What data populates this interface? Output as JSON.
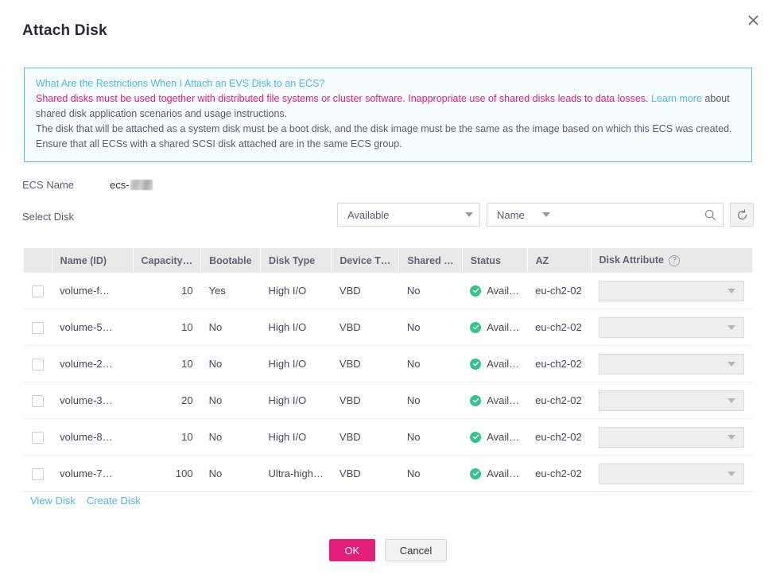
{
  "dialog": {
    "title": "Attach Disk",
    "close_icon": "close-icon"
  },
  "notice": {
    "heading_link": "What Are the Restrictions When I Attach an EVS Disk to an ECS?",
    "warning_part1": "Shared disks must be used together with distributed file systems or cluster software. Inappropriate use of shared disks leads to data losses. ",
    "warning_link": "Learn more",
    "warning_part2": " about shared disk application scenarios and usage instructions.",
    "line3": "The disk that will be attached as a system disk must be a boot disk, and the disk image must be the same as the image based on which this ECS was created.",
    "line4": "Ensure that all ECSs with a shared SCSI disk attached are in the same ECS group."
  },
  "form": {
    "ecs_name_label": "ECS Name",
    "ecs_name_value": "ecs-",
    "select_disk_label": "Select Disk"
  },
  "search": {
    "status_filter_value": "Available",
    "field_filter_value": "Name",
    "keyword_value": "",
    "keyword_placeholder": "",
    "search_icon": "search-icon",
    "refresh_icon": "refresh-icon"
  },
  "table": {
    "columns": [
      "Name (ID)",
      "Capacity…",
      "Bootable",
      "Disk Type",
      "Device T…",
      "Shared …",
      "Status",
      "AZ",
      "Disk Attribute"
    ],
    "disk_attribute_help_icon": "help-icon",
    "rows": [
      {
        "name": "volume-f…",
        "capacity": "10",
        "bootable": "Yes",
        "disk_type": "High I/O",
        "device_type": "VBD",
        "shared": "No",
        "status": "Avail…",
        "az": "eu-ch2-02",
        "disk_attribute": ""
      },
      {
        "name": "volume-5…",
        "capacity": "10",
        "bootable": "No",
        "disk_type": "High I/O",
        "device_type": "VBD",
        "shared": "No",
        "status": "Avail…",
        "az": "eu-ch2-02",
        "disk_attribute": ""
      },
      {
        "name": "volume-2…",
        "capacity": "10",
        "bootable": "No",
        "disk_type": "High I/O",
        "device_type": "VBD",
        "shared": "No",
        "status": "Avail…",
        "az": "eu-ch2-02",
        "disk_attribute": ""
      },
      {
        "name": "volume-3…",
        "capacity": "20",
        "bootable": "No",
        "disk_type": "High I/O",
        "device_type": "VBD",
        "shared": "No",
        "status": "Avail…",
        "az": "eu-ch2-02",
        "disk_attribute": ""
      },
      {
        "name": "volume-8…",
        "capacity": "10",
        "bootable": "No",
        "disk_type": "High I/O",
        "device_type": "VBD",
        "shared": "No",
        "status": "Avail…",
        "az": "eu-ch2-02",
        "disk_attribute": ""
      },
      {
        "name": "volume-7…",
        "capacity": "100",
        "bootable": "No",
        "disk_type": "Ultra-high…",
        "device_type": "VBD",
        "shared": "No",
        "status": "Avail…",
        "az": "eu-ch2-02",
        "disk_attribute": ""
      }
    ]
  },
  "table_links": {
    "view_disk": "View Disk",
    "create_disk": "Create Disk"
  },
  "footer": {
    "ok_label": "OK",
    "cancel_label": "Cancel"
  },
  "colors": {
    "primary_button": "#e41f7b",
    "notice_border": "#4ec0ef",
    "notice_background": "#f7fcff",
    "link": "#4cb8ee",
    "warning_text": "#ec1777",
    "status_ok": "#32c48d",
    "table_header_bg": "#e9e9e9"
  }
}
